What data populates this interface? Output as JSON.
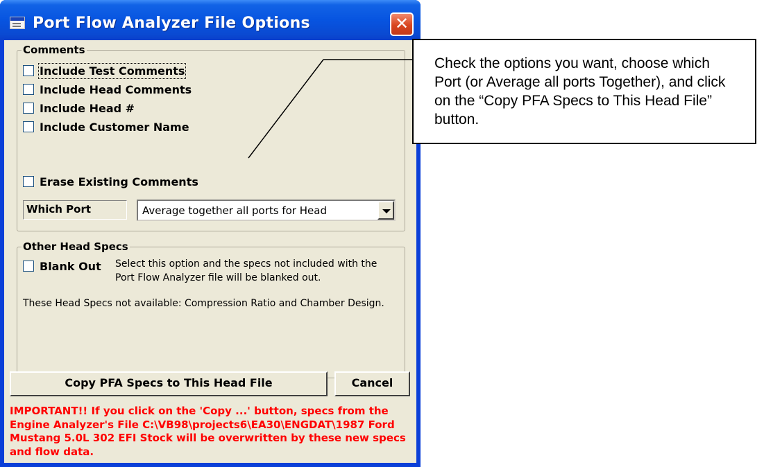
{
  "window": {
    "title": "Port Flow Analyzer File Options",
    "close_glyph": "✕"
  },
  "comments_group": {
    "label": "Comments",
    "checkboxes": [
      {
        "label": "Include Test Comments",
        "checked": false
      },
      {
        "label": "Include Head Comments",
        "checked": false
      },
      {
        "label": "Include Head #",
        "checked": false
      },
      {
        "label": "Include Customer Name",
        "checked": false
      }
    ],
    "erase_label": "Erase Existing Comments",
    "which_port_label": "Which Port",
    "which_port_value": "Average together all ports for Head"
  },
  "other_specs_group": {
    "label": "Other Head Specs",
    "blank_out_label": "Blank Out",
    "blank_out_desc": "Select this option and the specs not included with the Port Flow Analyzer file will be blanked out.",
    "not_available_text": "These Head Specs not available:  Compression Ratio and Chamber Design."
  },
  "buttons": {
    "copy_label": "Copy PFA Specs to This Head File",
    "cancel_label": "Cancel"
  },
  "important_text": "IMPORTANT!!  If you click on the 'Copy ...' button, specs from the Engine Analyzer's File C:\\VB98\\projects6\\EA30\\ENGDAT\\1987 Ford Mustang 5.0L 302 EFI Stock will be overwritten by these new specs and flow data.",
  "callout": {
    "text": "Check the options you want, choose which Port (or Average all ports Together), and click on the “Copy PFA Specs to This Head File” button."
  },
  "colors": {
    "title_bar": "#0754e0",
    "dialog_face": "#ece9d8",
    "warning_text": "#ff0000",
    "close_button": "#d9461f"
  }
}
